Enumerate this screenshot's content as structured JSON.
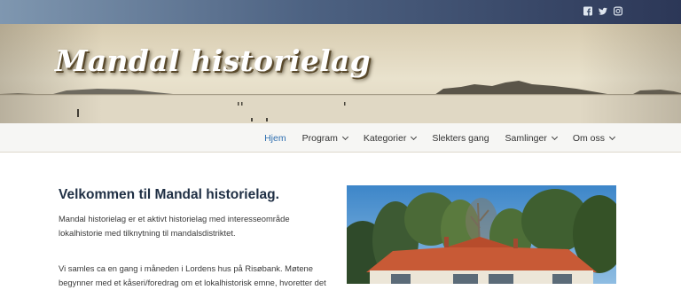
{
  "header": {
    "social": [
      {
        "icon": "facebook-icon"
      },
      {
        "icon": "twitter-icon"
      },
      {
        "icon": "instagram-icon"
      }
    ],
    "site_title": "Mandal historielag"
  },
  "nav": {
    "items": [
      {
        "label": "Hjem",
        "active": true,
        "dropdown": false
      },
      {
        "label": "Program",
        "active": false,
        "dropdown": true
      },
      {
        "label": "Kategorier",
        "active": false,
        "dropdown": true
      },
      {
        "label": "Slekters gang",
        "active": false,
        "dropdown": false
      },
      {
        "label": "Samlinger",
        "active": false,
        "dropdown": true
      },
      {
        "label": "Om oss",
        "active": false,
        "dropdown": true
      }
    ]
  },
  "main": {
    "heading": "Velkommen til Mandal historielag.",
    "paragraph1": "Mandal historielag er et aktivt historielag med interesseområde lokalhistorie med tilknytning til mandalsdistriktet.",
    "paragraph2": "Vi samles ca en gang i måneden i Lordens hus på Risøbank. Møtene begynner med et kåseri/foredrag om et lokalhistorisk emne, hvoretter det"
  },
  "colors": {
    "accent": "#2f6fb0",
    "heading": "#1f2f44",
    "topbar_start": "#7f97b0",
    "topbar_end": "#2c3757"
  }
}
